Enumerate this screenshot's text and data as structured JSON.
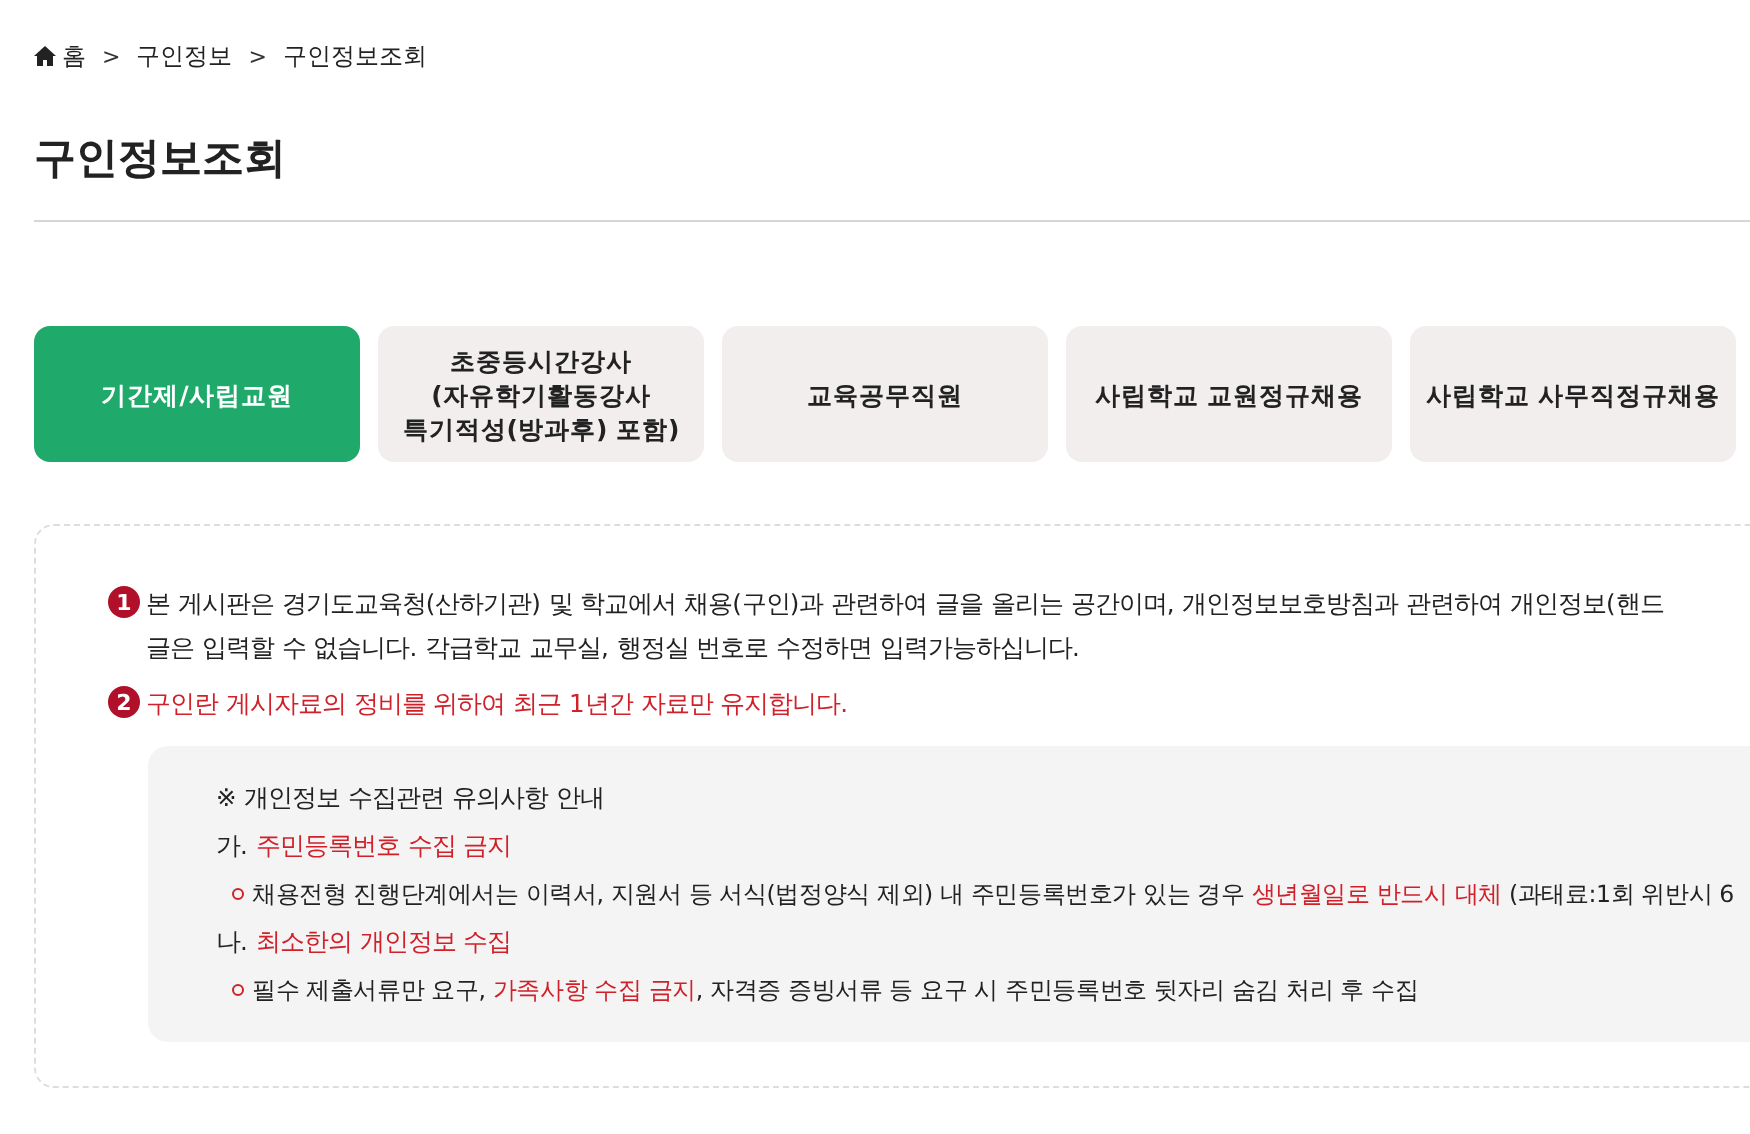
{
  "breadcrumb": {
    "items": [
      {
        "label": "홈",
        "kind": "home"
      },
      {
        "label": "구인정보",
        "kind": "link"
      },
      {
        "label": "구인정보조회",
        "kind": "link"
      }
    ],
    "separator": ">"
  },
  "page_title": "구인정보조회",
  "tabs": [
    {
      "lines": [
        "기간제/사립교원"
      ],
      "selected": true
    },
    {
      "lines": [
        "초중등시간강사",
        "(자유학기활동강사",
        "특기적성(방과후) 포함)"
      ],
      "selected": false
    },
    {
      "lines": [
        "교육공무직원"
      ],
      "selected": false
    },
    {
      "lines": [
        "사립학교 교원정규채용"
      ],
      "selected": false
    },
    {
      "lines": [
        "사립학교 사무직정규채용"
      ],
      "selected": false
    }
  ],
  "notices": [
    {
      "number": "1",
      "highlight": false,
      "lines": [
        "본 게시판은 경기도교육청(산하기관) 및 학교에서 채용(구인)과 관련하여 글을 올리는 공간이며, 개인정보보호방침과 관련하여 개인정보(핸드",
        "글은 입력할 수 없습니다. 각급학교 교무실, 행정실 번호로 수정하면 입력가능하십니다."
      ]
    },
    {
      "number": "2",
      "highlight": true,
      "lines": [
        "구인란 게시자료의 정비를 위하여 최근 1년간 자료만 유지합니다."
      ]
    }
  ],
  "privacy_guide": {
    "title": "※ 개인정보 수집관련 유의사항 안내",
    "sections": [
      {
        "marker": "가.",
        "heading": "주민등록번호 수집 금지",
        "bullets": [
          [
            {
              "text": "채용전형 진행단계에서는 이력서, 지원서 등 서식(법정양식 제외) 내 주민등록번호가 있는 경우 ",
              "highlight": false
            },
            {
              "text": "생년월일로 반드시 대체",
              "highlight": true
            },
            {
              "text": " (과태료:1회 위반시 6",
              "highlight": false
            }
          ]
        ]
      },
      {
        "marker": "나.",
        "heading": "최소한의 개인정보 수집",
        "bullets": [
          [
            {
              "text": "필수 제출서류만 요구, ",
              "highlight": false
            },
            {
              "text": "가족사항 수집 금지",
              "highlight": true
            },
            {
              "text": ", 자격증 증빙서류 등 요구 시 주민등록번호 뒷자리 숨김 처리 후 수집",
              "highlight": false
            }
          ]
        ]
      }
    ]
  }
}
